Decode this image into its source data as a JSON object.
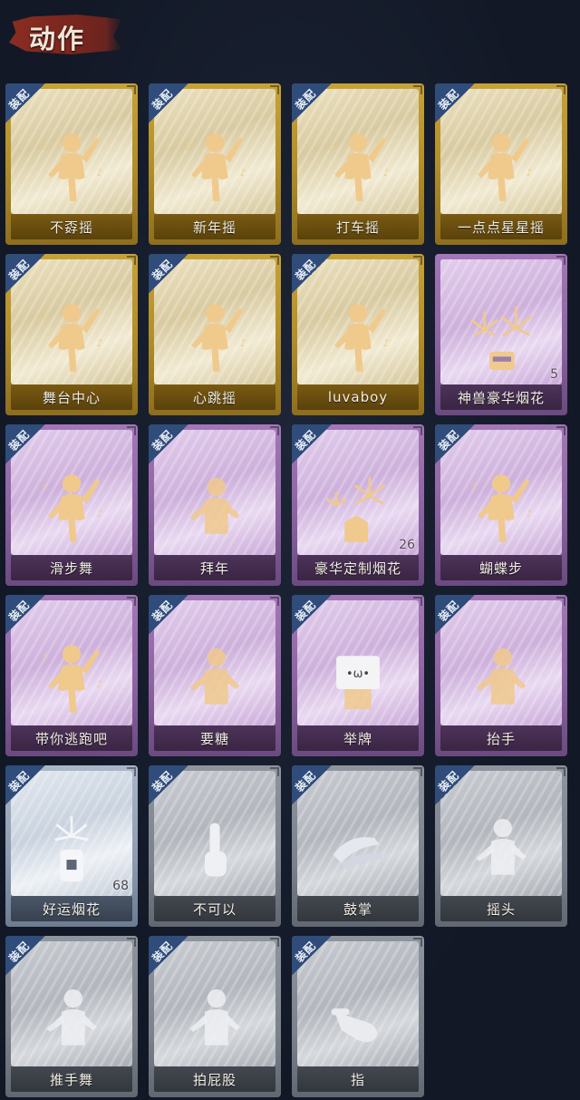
{
  "header": {
    "title": "动作"
  },
  "equip_tag": "装配",
  "colors": {
    "gold": "#c7a236",
    "purple": "#a477b8",
    "blue": "#aab6c8",
    "grey": "#8f959e",
    "tag": "#2f4c7a",
    "header_brush": "#8a2d22"
  },
  "cards": [
    {
      "label": "不孬摇",
      "rarity": "gold",
      "equip": true,
      "icon": "dancer-icon"
    },
    {
      "label": "新年摇",
      "rarity": "gold",
      "equip": true,
      "icon": "dancer-icon"
    },
    {
      "label": "打车摇",
      "rarity": "gold",
      "equip": true,
      "icon": "dancer-icon"
    },
    {
      "label": "一点点星星摇",
      "rarity": "gold",
      "equip": true,
      "icon": "dancer-icon"
    },
    {
      "label": "舞台中心",
      "rarity": "gold",
      "equip": true,
      "icon": "dancer-icon"
    },
    {
      "label": "心跳摇",
      "rarity": "gold",
      "equip": true,
      "icon": "dancer-icon"
    },
    {
      "label": "luvaboy",
      "rarity": "gold",
      "equip": true,
      "icon": "dancer-icon"
    },
    {
      "label": "神兽豪华烟花",
      "rarity": "purple",
      "equip": false,
      "icon": "firework-icon",
      "count": "5"
    },
    {
      "label": "滑步舞",
      "rarity": "purple",
      "equip": true,
      "icon": "dancer-icon"
    },
    {
      "label": "拜年",
      "rarity": "purple",
      "equip": true,
      "icon": "figure-icon"
    },
    {
      "label": "豪华定制烟花",
      "rarity": "purple",
      "equip": true,
      "icon": "firework-box-icon",
      "count": "26"
    },
    {
      "label": "蝴蝶步",
      "rarity": "purple",
      "equip": true,
      "icon": "dancer-icon"
    },
    {
      "label": "带你逃跑吧",
      "rarity": "purple",
      "equip": true,
      "icon": "dancer-icon"
    },
    {
      "label": "要糖",
      "rarity": "purple",
      "equip": true,
      "icon": "figure-icon"
    },
    {
      "label": "举牌",
      "rarity": "purple",
      "equip": true,
      "icon": "sign-icon"
    },
    {
      "label": "抬手",
      "rarity": "purple",
      "equip": true,
      "icon": "figure-icon"
    },
    {
      "label": "好运烟花",
      "rarity": "blue",
      "equip": true,
      "icon": "firework-can-icon",
      "count": "68"
    },
    {
      "label": "不可以",
      "rarity": "grey",
      "equip": true,
      "icon": "finger-icon"
    },
    {
      "label": "鼓掌",
      "rarity": "grey",
      "equip": true,
      "icon": "clap-icon"
    },
    {
      "label": "摇头",
      "rarity": "grey",
      "equip": true,
      "icon": "figure-icon"
    },
    {
      "label": "推手舞",
      "rarity": "grey",
      "equip": true,
      "icon": "figure-icon"
    },
    {
      "label": "拍屁股",
      "rarity": "grey",
      "equip": true,
      "icon": "figure-icon"
    },
    {
      "label": "指",
      "rarity": "grey",
      "equip": true,
      "icon": "point-icon"
    }
  ]
}
